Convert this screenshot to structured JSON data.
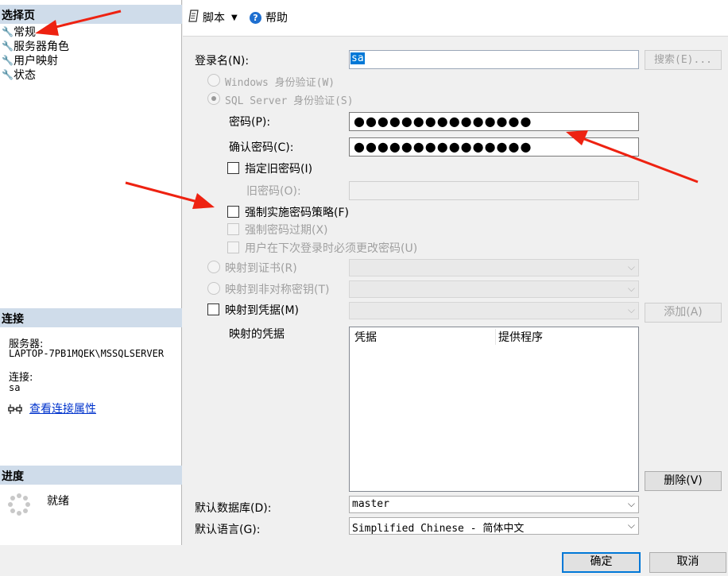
{
  "left": {
    "select_page": {
      "title": "选择页",
      "items": [
        {
          "label": "常规"
        },
        {
          "label": "服务器角色"
        },
        {
          "label": "用户映射"
        },
        {
          "label": "状态"
        }
      ]
    },
    "connection": {
      "title": "连接",
      "server_label": "服务器:",
      "server_value": "LAPTOP-7PB1MQEK\\MSSQLSERVER",
      "conn_label": "连接:",
      "conn_value": "sa",
      "link": "查看连接属性"
    },
    "progress": {
      "title": "进度",
      "status": "就绪"
    }
  },
  "toolbar": {
    "script_label": "脚本",
    "help_label": "帮助"
  },
  "form": {
    "login_name_label": "登录名(N):",
    "login_name_value": "sa",
    "search_button": "搜索(E)...",
    "windows_auth": "Windows 身份验证(W)",
    "sql_auth": "SQL Server 身份验证(S)",
    "password_label": "密码(P):",
    "password_value": "●●●●●●●●●●●●●●●",
    "confirm_label": "确认密码(C):",
    "confirm_value": "●●●●●●●●●●●●●●●",
    "specify_old": "指定旧密码(I)",
    "old_password_label": "旧密码(O):",
    "enforce_policy": "强制实施密码策略(F)",
    "enforce_expiration": "强制密码过期(X)",
    "must_change": "用户在下次登录时必须更改密码(U)",
    "map_cert": "映射到证书(R)",
    "map_asym": "映射到非对称密钥(T)",
    "map_cred": "映射到凭据(M)",
    "add_button": "添加(A)",
    "mapped_creds_label": "映射的凭据",
    "col_credential": "凭据",
    "col_provider": "提供程序",
    "remove_button": "删除(V)",
    "default_db_label": "默认数据库(D):",
    "default_db_value": "master",
    "default_lang_label": "默认语言(G):",
    "default_lang_value": "Simplified Chinese - 简体中文"
  },
  "footer": {
    "ok": "确定",
    "cancel": "取消"
  },
  "colors": {
    "section_header": "#cfdcea",
    "annotation_arrow": "#ee2211",
    "selection": "#0078d7"
  }
}
